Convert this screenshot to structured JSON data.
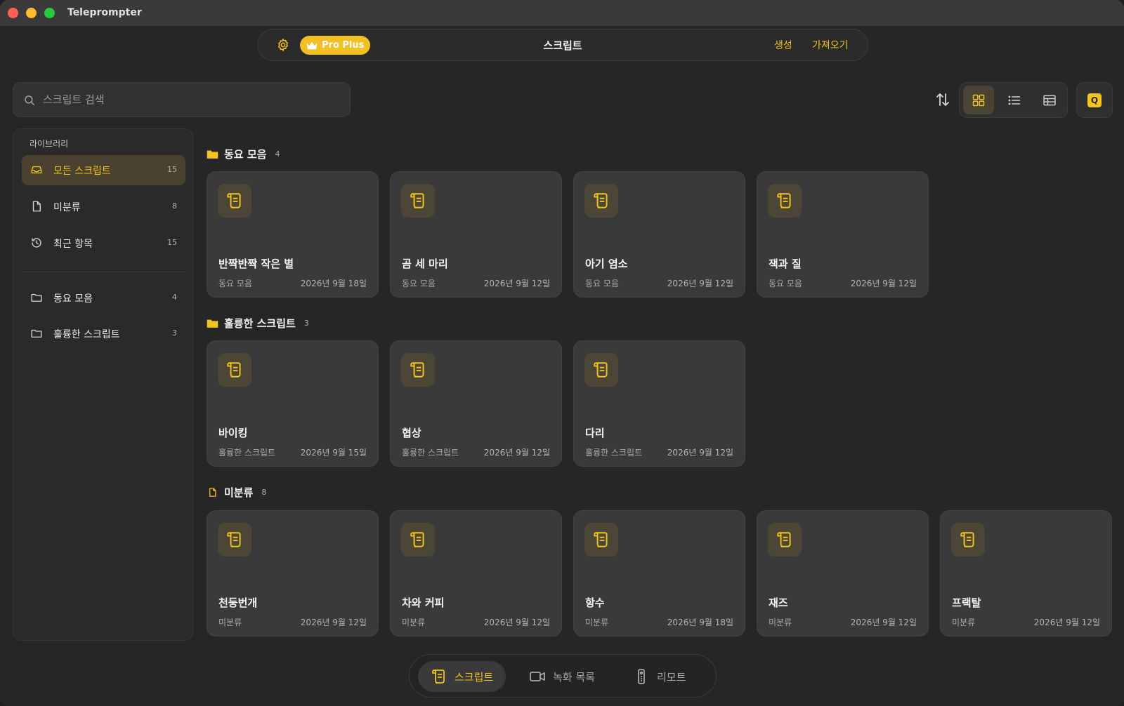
{
  "app": {
    "title": "Teleprompter"
  },
  "topbar": {
    "title": "스크립트",
    "badge": "Pro Plus",
    "create_label": "생성",
    "import_label": "가져오기"
  },
  "search": {
    "placeholder": "스크립트 검색",
    "value": ""
  },
  "toolbar": {
    "q_label": "Q",
    "active_view": "grid"
  },
  "sidebar": {
    "header": "라이브러리",
    "items": [
      {
        "label": "모든 스크립트",
        "count": "15",
        "icon": "inbox-icon",
        "active": true
      },
      {
        "label": "미분류",
        "count": "8",
        "icon": "document-icon"
      },
      {
        "label": "최근 항목",
        "count": "15",
        "icon": "history-icon"
      }
    ],
    "folders": [
      {
        "label": "동요 모음",
        "count": "4",
        "icon": "folder-icon"
      },
      {
        "label": "훌륭한 스크립트",
        "count": "3",
        "icon": "folder-icon"
      }
    ]
  },
  "sections": [
    {
      "title": "동요 모음",
      "count": "4",
      "cards": [
        {
          "title": "반짝반짝 작은 별",
          "folder": "동요 모음",
          "date": "2026년 9월 18일"
        },
        {
          "title": "곰 세 마리",
          "folder": "동요 모음",
          "date": "2026년 9월 12일"
        },
        {
          "title": "아기 염소",
          "folder": "동요 모음",
          "date": "2026년 9월 12일"
        },
        {
          "title": "잭과 질",
          "folder": "동요 모음",
          "date": "2026년 9월 12일"
        }
      ]
    },
    {
      "title": "훌륭한 스크립트",
      "count": "3",
      "cards": [
        {
          "title": "바이킹",
          "folder": "훌륭한 스크립트",
          "date": "2026년 9월 15일"
        },
        {
          "title": "협상",
          "folder": "훌륭한 스크립트",
          "date": "2026년 9월 12일"
        },
        {
          "title": "다리",
          "folder": "훌륭한 스크립트",
          "date": "2026년 9월 12일"
        }
      ]
    },
    {
      "title": "미분류",
      "count": "8",
      "cards": [
        {
          "title": "천둥번개",
          "folder": "미분류",
          "date": "2026년 9월 12일"
        },
        {
          "title": "차와 커피",
          "folder": "미분류",
          "date": "2026년 9월 12일"
        },
        {
          "title": "항수",
          "folder": "미분류",
          "date": "2026년 9월 18일"
        },
        {
          "title": "재즈",
          "folder": "미분류",
          "date": "2026년 9월 12일"
        },
        {
          "title": "프랙탈",
          "folder": "미분류",
          "date": "2026년 9월 12일"
        }
      ]
    }
  ],
  "bottom_nav": {
    "items": [
      {
        "label": "스크립트",
        "active": true
      },
      {
        "label": "녹화 목록"
      },
      {
        "label": "리모트"
      }
    ]
  },
  "colors": {
    "accent": "#f2c321",
    "background": "#262626",
    "card": "#3a3a3a"
  }
}
